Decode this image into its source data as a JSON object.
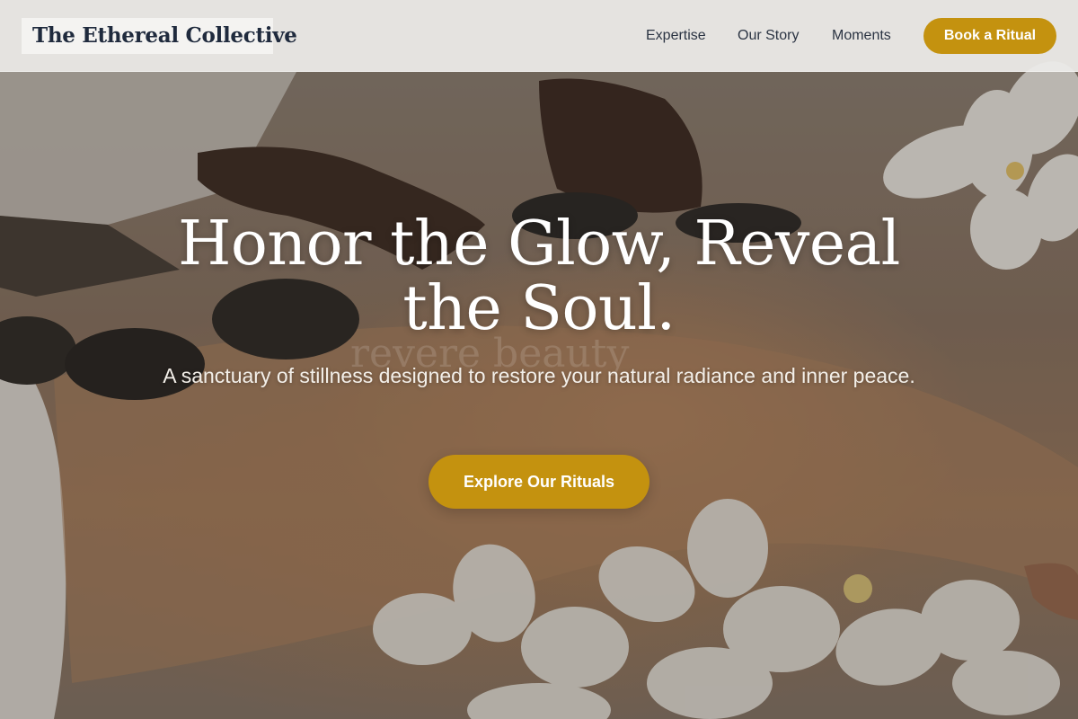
{
  "header": {
    "brand": "The Ethereal Collective",
    "nav": [
      {
        "label": "Expertise"
      },
      {
        "label": "Our Story"
      },
      {
        "label": "Moments"
      }
    ],
    "cta_label": "Book a Ritual"
  },
  "hero": {
    "background_description_icon": "massage-hot-stones-orchids-image",
    "ghost_text": "revere beauty",
    "headline": "Honor the Glow, Reveal the Soul.",
    "subheadline": "A sanctuary of stillness designed to restore your natural radiance and inner peace.",
    "cta_label": "Explore Our Rituals"
  },
  "colors": {
    "accent": "#c4920f",
    "brand_text": "#1f2a3d",
    "nav_text": "#2b3443",
    "header_bg": "#ecebe9"
  }
}
